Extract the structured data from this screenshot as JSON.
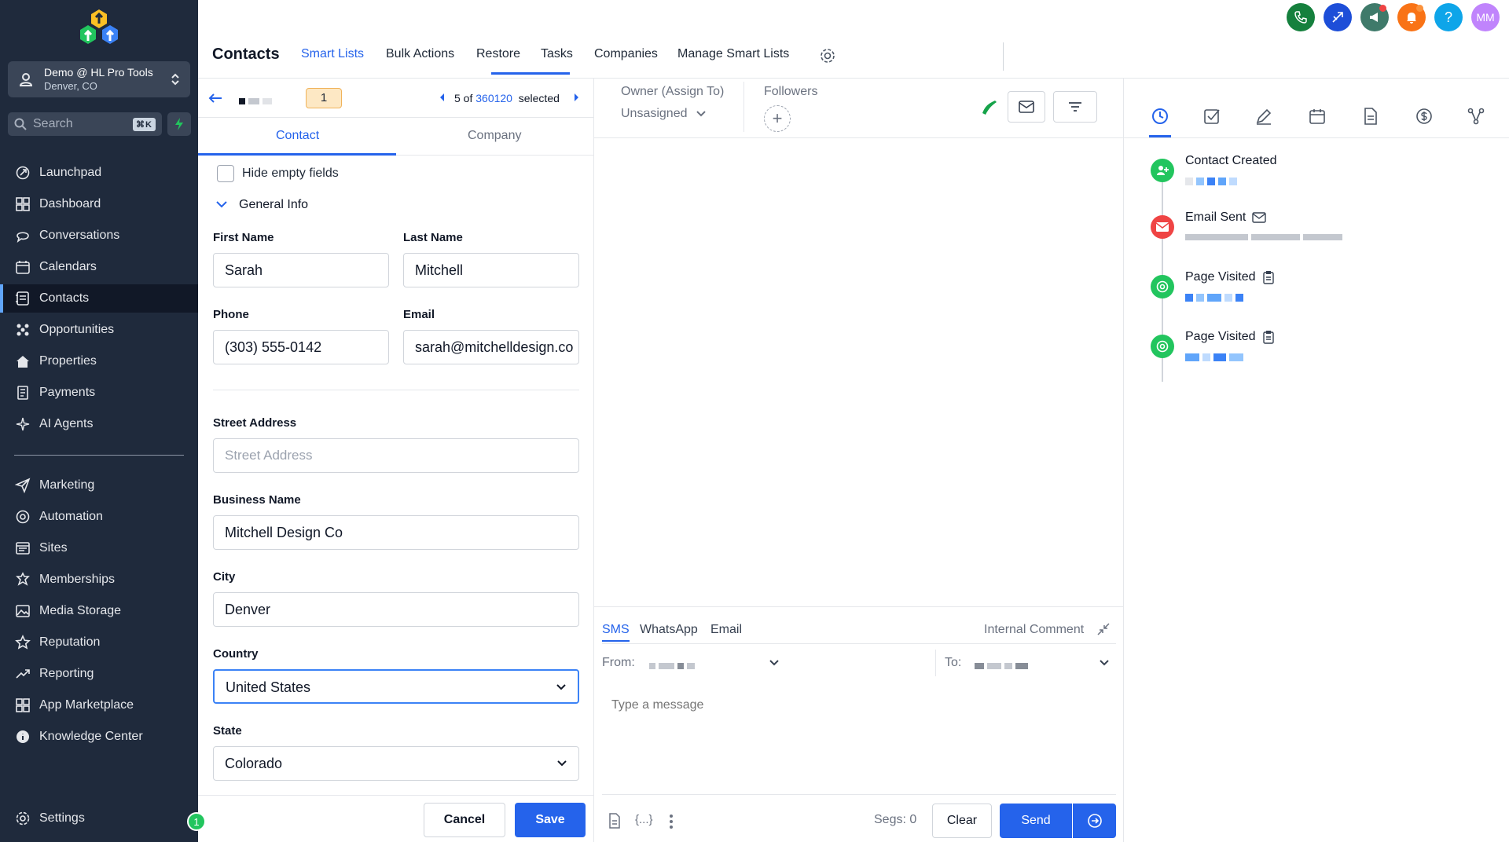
{
  "sidebar": {
    "account": {
      "name": "Demo @ HL Pro Tools",
      "location": "Denver, CO"
    },
    "search": {
      "placeholder": "Search",
      "shortcut": "⌘K"
    },
    "items": [
      {
        "label": "Launchpad",
        "icon": "rocket-icon"
      },
      {
        "label": "Dashboard",
        "icon": "grid-icon"
      },
      {
        "label": "Conversations",
        "icon": "chat-icon"
      },
      {
        "label": "Calendars",
        "icon": "calendar-icon"
      },
      {
        "label": "Contacts",
        "icon": "contacts-icon"
      },
      {
        "label": "Opportunities",
        "icon": "opportunities-icon"
      },
      {
        "label": "Properties",
        "icon": "home-icon"
      },
      {
        "label": "Payments",
        "icon": "payments-icon"
      },
      {
        "label": "AI Agents",
        "icon": "sparkle-icon"
      },
      {
        "label": "Marketing",
        "icon": "send-icon"
      },
      {
        "label": "Automation",
        "icon": "automation-icon"
      },
      {
        "label": "Sites",
        "icon": "sites-icon"
      },
      {
        "label": "Memberships",
        "icon": "badge-icon"
      },
      {
        "label": "Media Storage",
        "icon": "image-icon"
      },
      {
        "label": "Reputation",
        "icon": "star-icon"
      },
      {
        "label": "Reporting",
        "icon": "trend-icon"
      },
      {
        "label": "App Marketplace",
        "icon": "apps-icon"
      },
      {
        "label": "Knowledge Center",
        "icon": "info-icon"
      }
    ],
    "settings_label": "Settings",
    "settings_badge": "1"
  },
  "header": {
    "title": "Contacts",
    "tabs": [
      "Smart Lists",
      "Bulk Actions",
      "Restore",
      "Tasks",
      "Companies",
      "Manage Smart Lists"
    ],
    "avatar_initials": "MM",
    "help_label": "?"
  },
  "record_nav": {
    "current_index": "1",
    "position_text": "5 of",
    "total": "360120",
    "selected_label": "selected"
  },
  "detail_tabs": [
    "Contact",
    "Company"
  ],
  "form": {
    "hide_empty_label": "Hide empty fields",
    "section_title": "General Info",
    "first_name": {
      "label": "First Name",
      "value": "Sarah"
    },
    "last_name": {
      "label": "Last Name",
      "value": "Mitchell"
    },
    "phone": {
      "label": "Phone",
      "value": "(303) 555-0142"
    },
    "email": {
      "label": "Email",
      "value": "sarah@mitchelldesign.co"
    },
    "street": {
      "label": "Street Address",
      "placeholder": "Street Address"
    },
    "business": {
      "label": "Business Name",
      "value": "Mitchell Design Co"
    },
    "city": {
      "label": "City",
      "value": "Denver"
    },
    "country": {
      "label": "Country",
      "value": "United States"
    },
    "state": {
      "label": "State",
      "value": "Colorado"
    },
    "cancel_label": "Cancel",
    "save_label": "Save"
  },
  "conversation": {
    "owner_label": "Owner (Assign To)",
    "owner_value": "Unsasigned",
    "followers_label": "Followers",
    "followers_add": "+",
    "channels": [
      "SMS",
      "WhatsApp",
      "Email"
    ],
    "internal_comment": "Internal Comment",
    "from_label": "From:",
    "to_label": "To:",
    "message_placeholder": "Type a message",
    "variables_label": "{...}",
    "segs_label": "Segs: 0",
    "clear_label": "Clear",
    "send_label": "Send"
  },
  "activity": {
    "events": [
      {
        "title": "Contact Created",
        "color": "#22c55e",
        "icon": "add-user-icon"
      },
      {
        "title": "Email Sent",
        "color": "#ef4444",
        "icon": "mail-icon"
      },
      {
        "title": "Page Visited",
        "color": "#22c55e",
        "icon": "at-icon"
      },
      {
        "title": "Page Visited",
        "color": "#22c55e",
        "icon": "at-icon"
      }
    ]
  },
  "colors": {
    "sidebar": "#1f2a3c",
    "accent": "#2563eb",
    "highlight": "#fde8c4"
  }
}
